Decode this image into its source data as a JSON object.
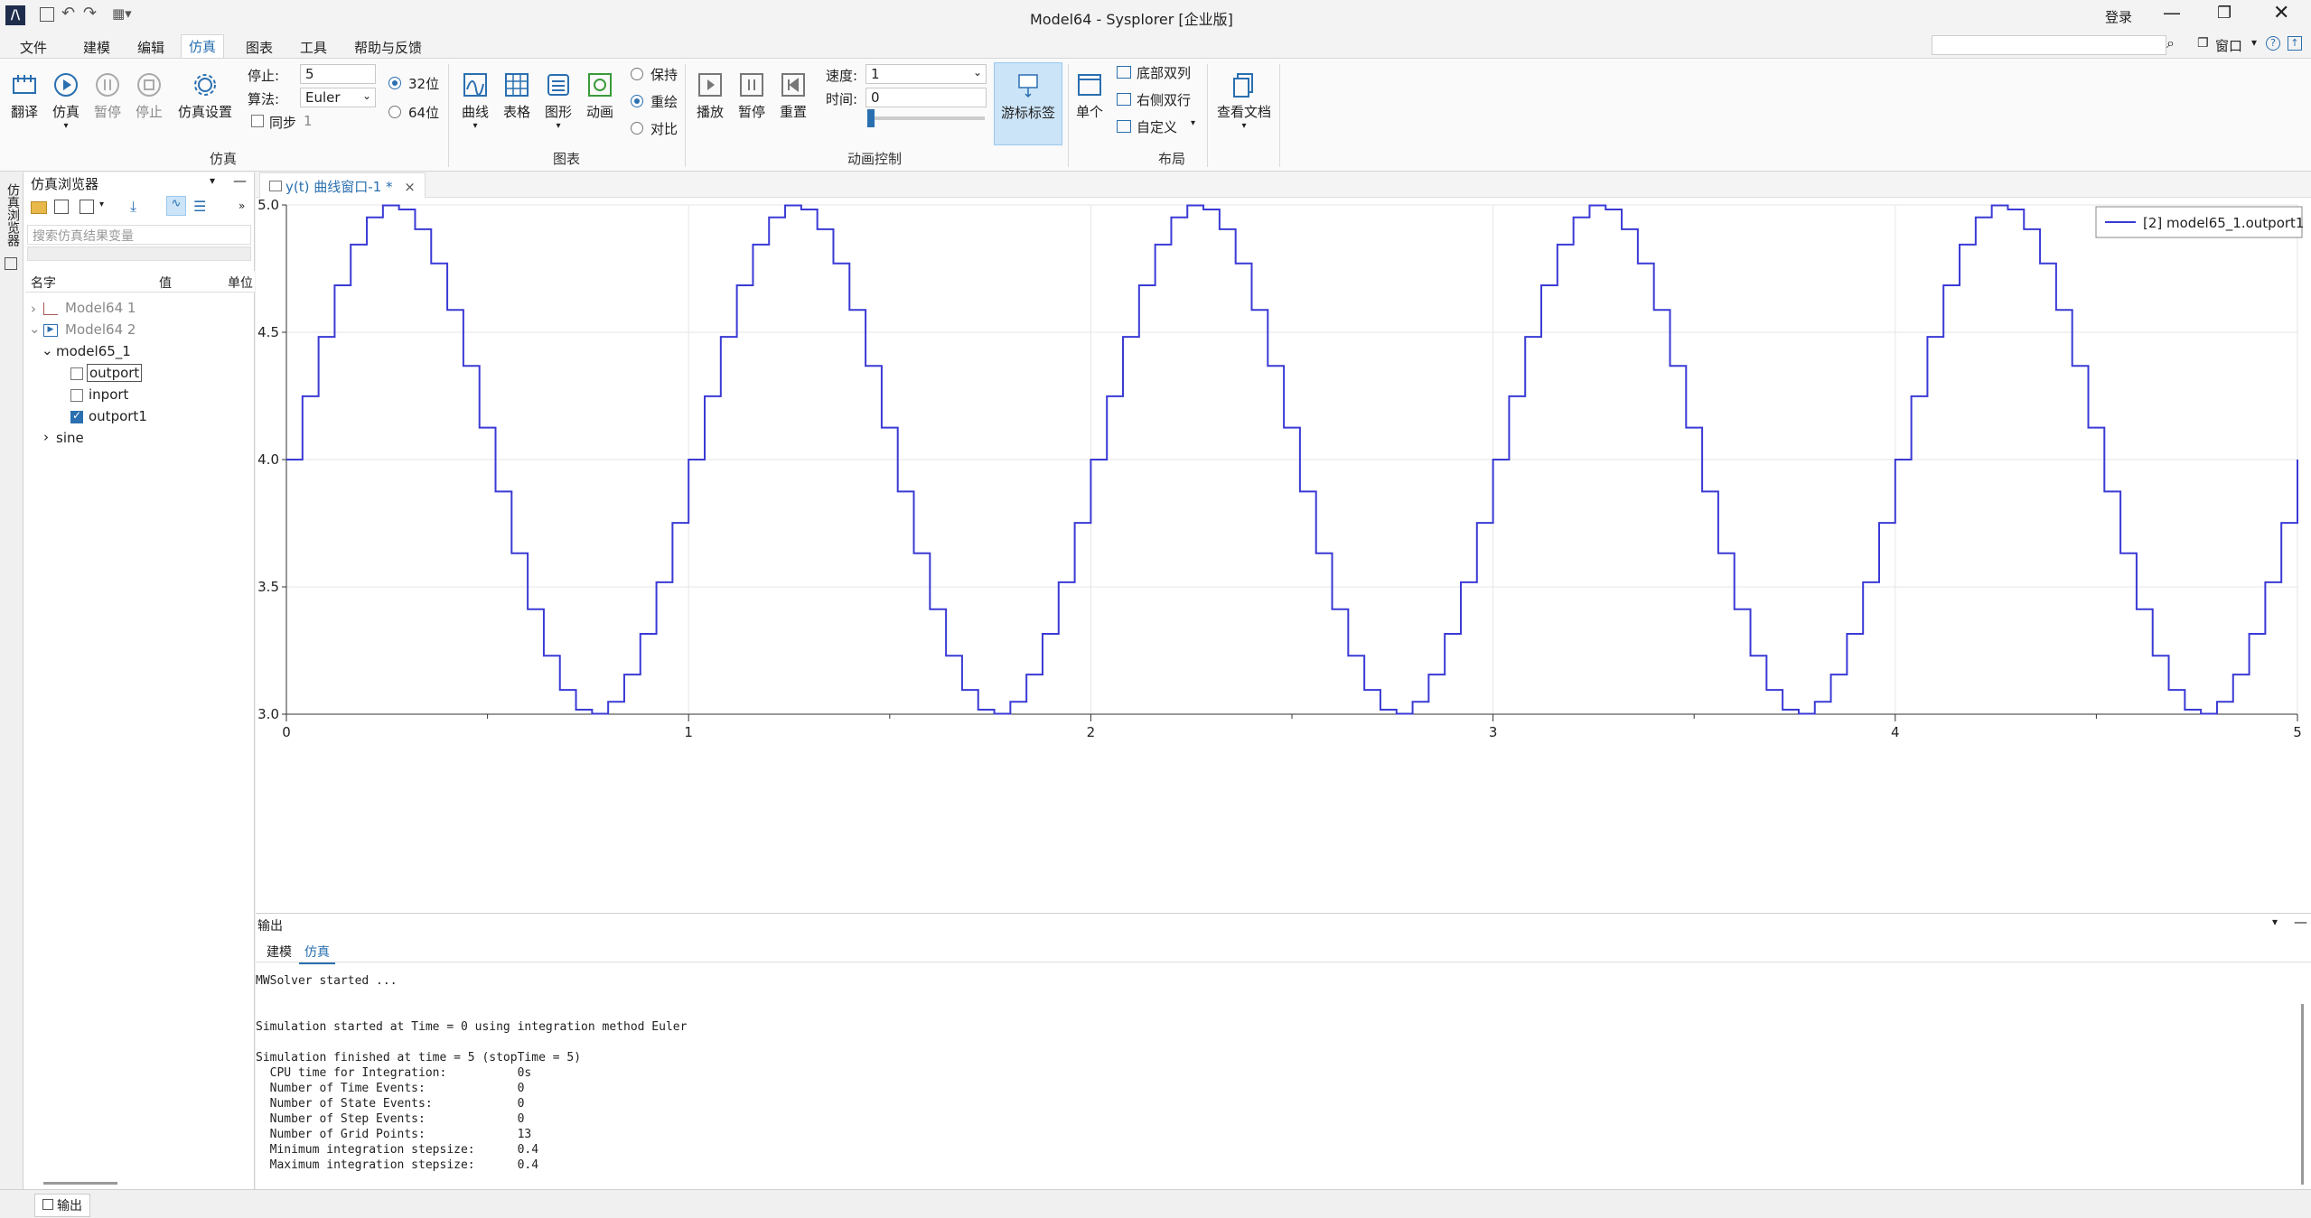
{
  "window": {
    "title": "Model64 - Sysplorer [企业版]",
    "login": "登录",
    "search_placeholder": "搜索",
    "window_menu": "窗口"
  },
  "menus": [
    "文件",
    "建模",
    "编辑",
    "仿真",
    "图表",
    "工具",
    "帮助与反馈"
  ],
  "active_menu": "仿真",
  "ribbon": {
    "sim_group": {
      "label": "仿真",
      "buttons": [
        "翻译",
        "仿真",
        "暂停",
        "停止",
        "仿真设置"
      ],
      "stop_label": "停止:",
      "stop_value": "5",
      "algo_label": "算法:",
      "algo_value": "Euler",
      "sync_label": "同步",
      "sync_value": "1",
      "bit32": "32位",
      "bit64": "64位"
    },
    "chart_group": {
      "label": "图表",
      "buttons": [
        "曲线",
        "表格",
        "图形",
        "动画"
      ],
      "radios": [
        "保持",
        "重绘",
        "对比"
      ]
    },
    "anim_group": {
      "label": "动画控制",
      "buttons": [
        "播放",
        "暂停",
        "重置"
      ],
      "speed_label": "速度:",
      "speed_value": "1",
      "time_label": "时间:",
      "time_value": "0",
      "cursor_label": "游标标签"
    },
    "layout_group": {
      "label": "布局",
      "single": "单个",
      "options": [
        "底部双列",
        "右侧双行",
        "自定义"
      ]
    },
    "doc_button": "查看文档"
  },
  "browser": {
    "vertical_tab": "仿真浏览器",
    "title": "仿真浏览器",
    "search_placeholder": "搜索仿真结果变量",
    "columns": [
      "名字",
      "值",
      "单位"
    ],
    "tree": {
      "model1": "Model64 1",
      "model2": "Model64 2",
      "sub": "model65_1",
      "vars": [
        "outport",
        "inport",
        "outport1"
      ],
      "sine": "sine"
    }
  },
  "plot_tab": {
    "label": "y(t) 曲线窗口-1 *"
  },
  "chart_data": {
    "type": "line",
    "series": [
      {
        "name": "[2] model65_1.outport1",
        "color": "#3a3ad6",
        "description_points": "sampled-and-held sine: 4 + sin(2*pi*t), step 0.04",
        "step": 0.04,
        "amplitude": 1,
        "offset": 4,
        "frequency": 1
      }
    ],
    "xlim": [
      0,
      5
    ],
    "ylim": [
      3.0,
      5.0
    ],
    "x_ticks": [
      "0",
      "1",
      "2",
      "3",
      "4",
      "5"
    ],
    "y_ticks": [
      "5.0",
      "4.5",
      "4.0",
      "3.5",
      "3.0"
    ],
    "grid": true,
    "legend": "top-right"
  },
  "output": {
    "title": "输出",
    "tabs": [
      "建模",
      "仿真"
    ],
    "active_tab": "仿真",
    "lines": [
      "MWSolver started ...",
      "",
      "",
      "Simulation started at Time = 0 using integration method Euler",
      "",
      "Simulation finished at time = 5 (stopTime = 5)",
      "  CPU time for Integration:          0s",
      "  Number of Time Events:             0",
      "  Number of State Events:            0",
      "  Number of Step Events:             0",
      "  Number of Grid Points:             13",
      "  Minimum integration stepsize:      0.4",
      "  Maximum integration stepsize:      0.4"
    ]
  },
  "status": {
    "tab": "输出"
  }
}
